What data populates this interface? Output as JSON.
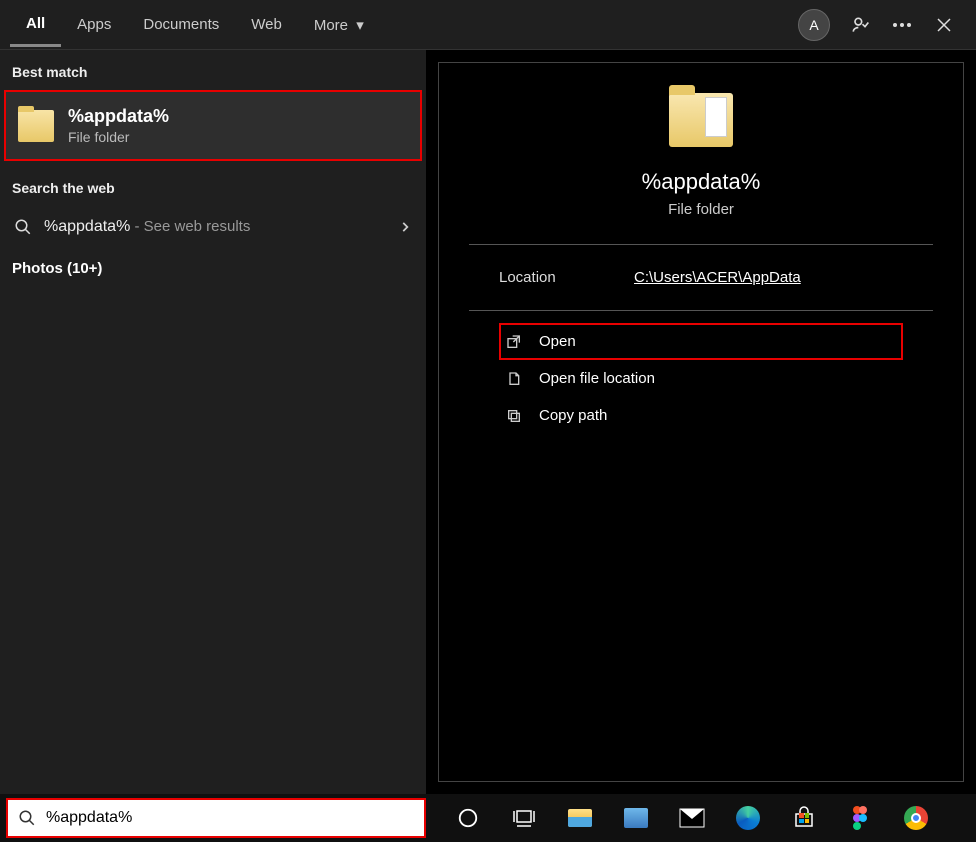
{
  "tabs": {
    "all": "All",
    "apps": "Apps",
    "documents": "Documents",
    "web": "Web",
    "more": "More"
  },
  "user_initial": "A",
  "left": {
    "best_match_header": "Best match",
    "result_title": "%appdata%",
    "result_sub": "File folder",
    "search_web_header": "Search the web",
    "web_query": "%appdata%",
    "web_hint": " - See web results",
    "photos": "Photos (10+)"
  },
  "preview": {
    "title": "%appdata%",
    "sub": "File folder",
    "location_label": "Location",
    "location_path": "C:\\Users\\ACER\\AppData",
    "actions": {
      "open": "Open",
      "open_location": "Open file location",
      "copy_path": "Copy path"
    }
  },
  "search_value": "%appdata%"
}
